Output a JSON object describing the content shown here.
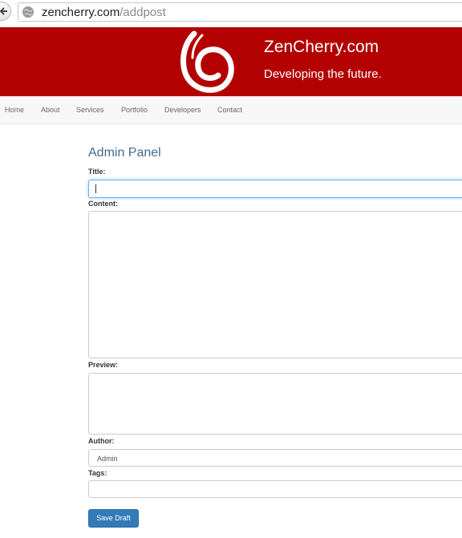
{
  "browser": {
    "url_host": "zencherry.com",
    "url_path": "/addpost"
  },
  "header": {
    "brand": "ZenCherry.com",
    "tagline": "Developing the future.",
    "colors": {
      "background": "#b30000",
      "text": "#ffffff"
    }
  },
  "nav": {
    "items": [
      "Home",
      "About",
      "Services",
      "Portfolio",
      "Developers",
      "Contact"
    ]
  },
  "form": {
    "title": "Admin Panel",
    "fields": {
      "title": {
        "label": "Title:",
        "value": ""
      },
      "content": {
        "label": "Content:",
        "value": ""
      },
      "preview": {
        "label": "Preview:",
        "value": ""
      },
      "author": {
        "label": "Author:",
        "value": "Admin"
      },
      "tags": {
        "label": "Tags:",
        "value": ""
      }
    },
    "save_label": "Save Draft"
  },
  "icons": {
    "back": "back-arrow-icon",
    "site": "globe-icon",
    "logo": "zencherry-logo-icon"
  }
}
